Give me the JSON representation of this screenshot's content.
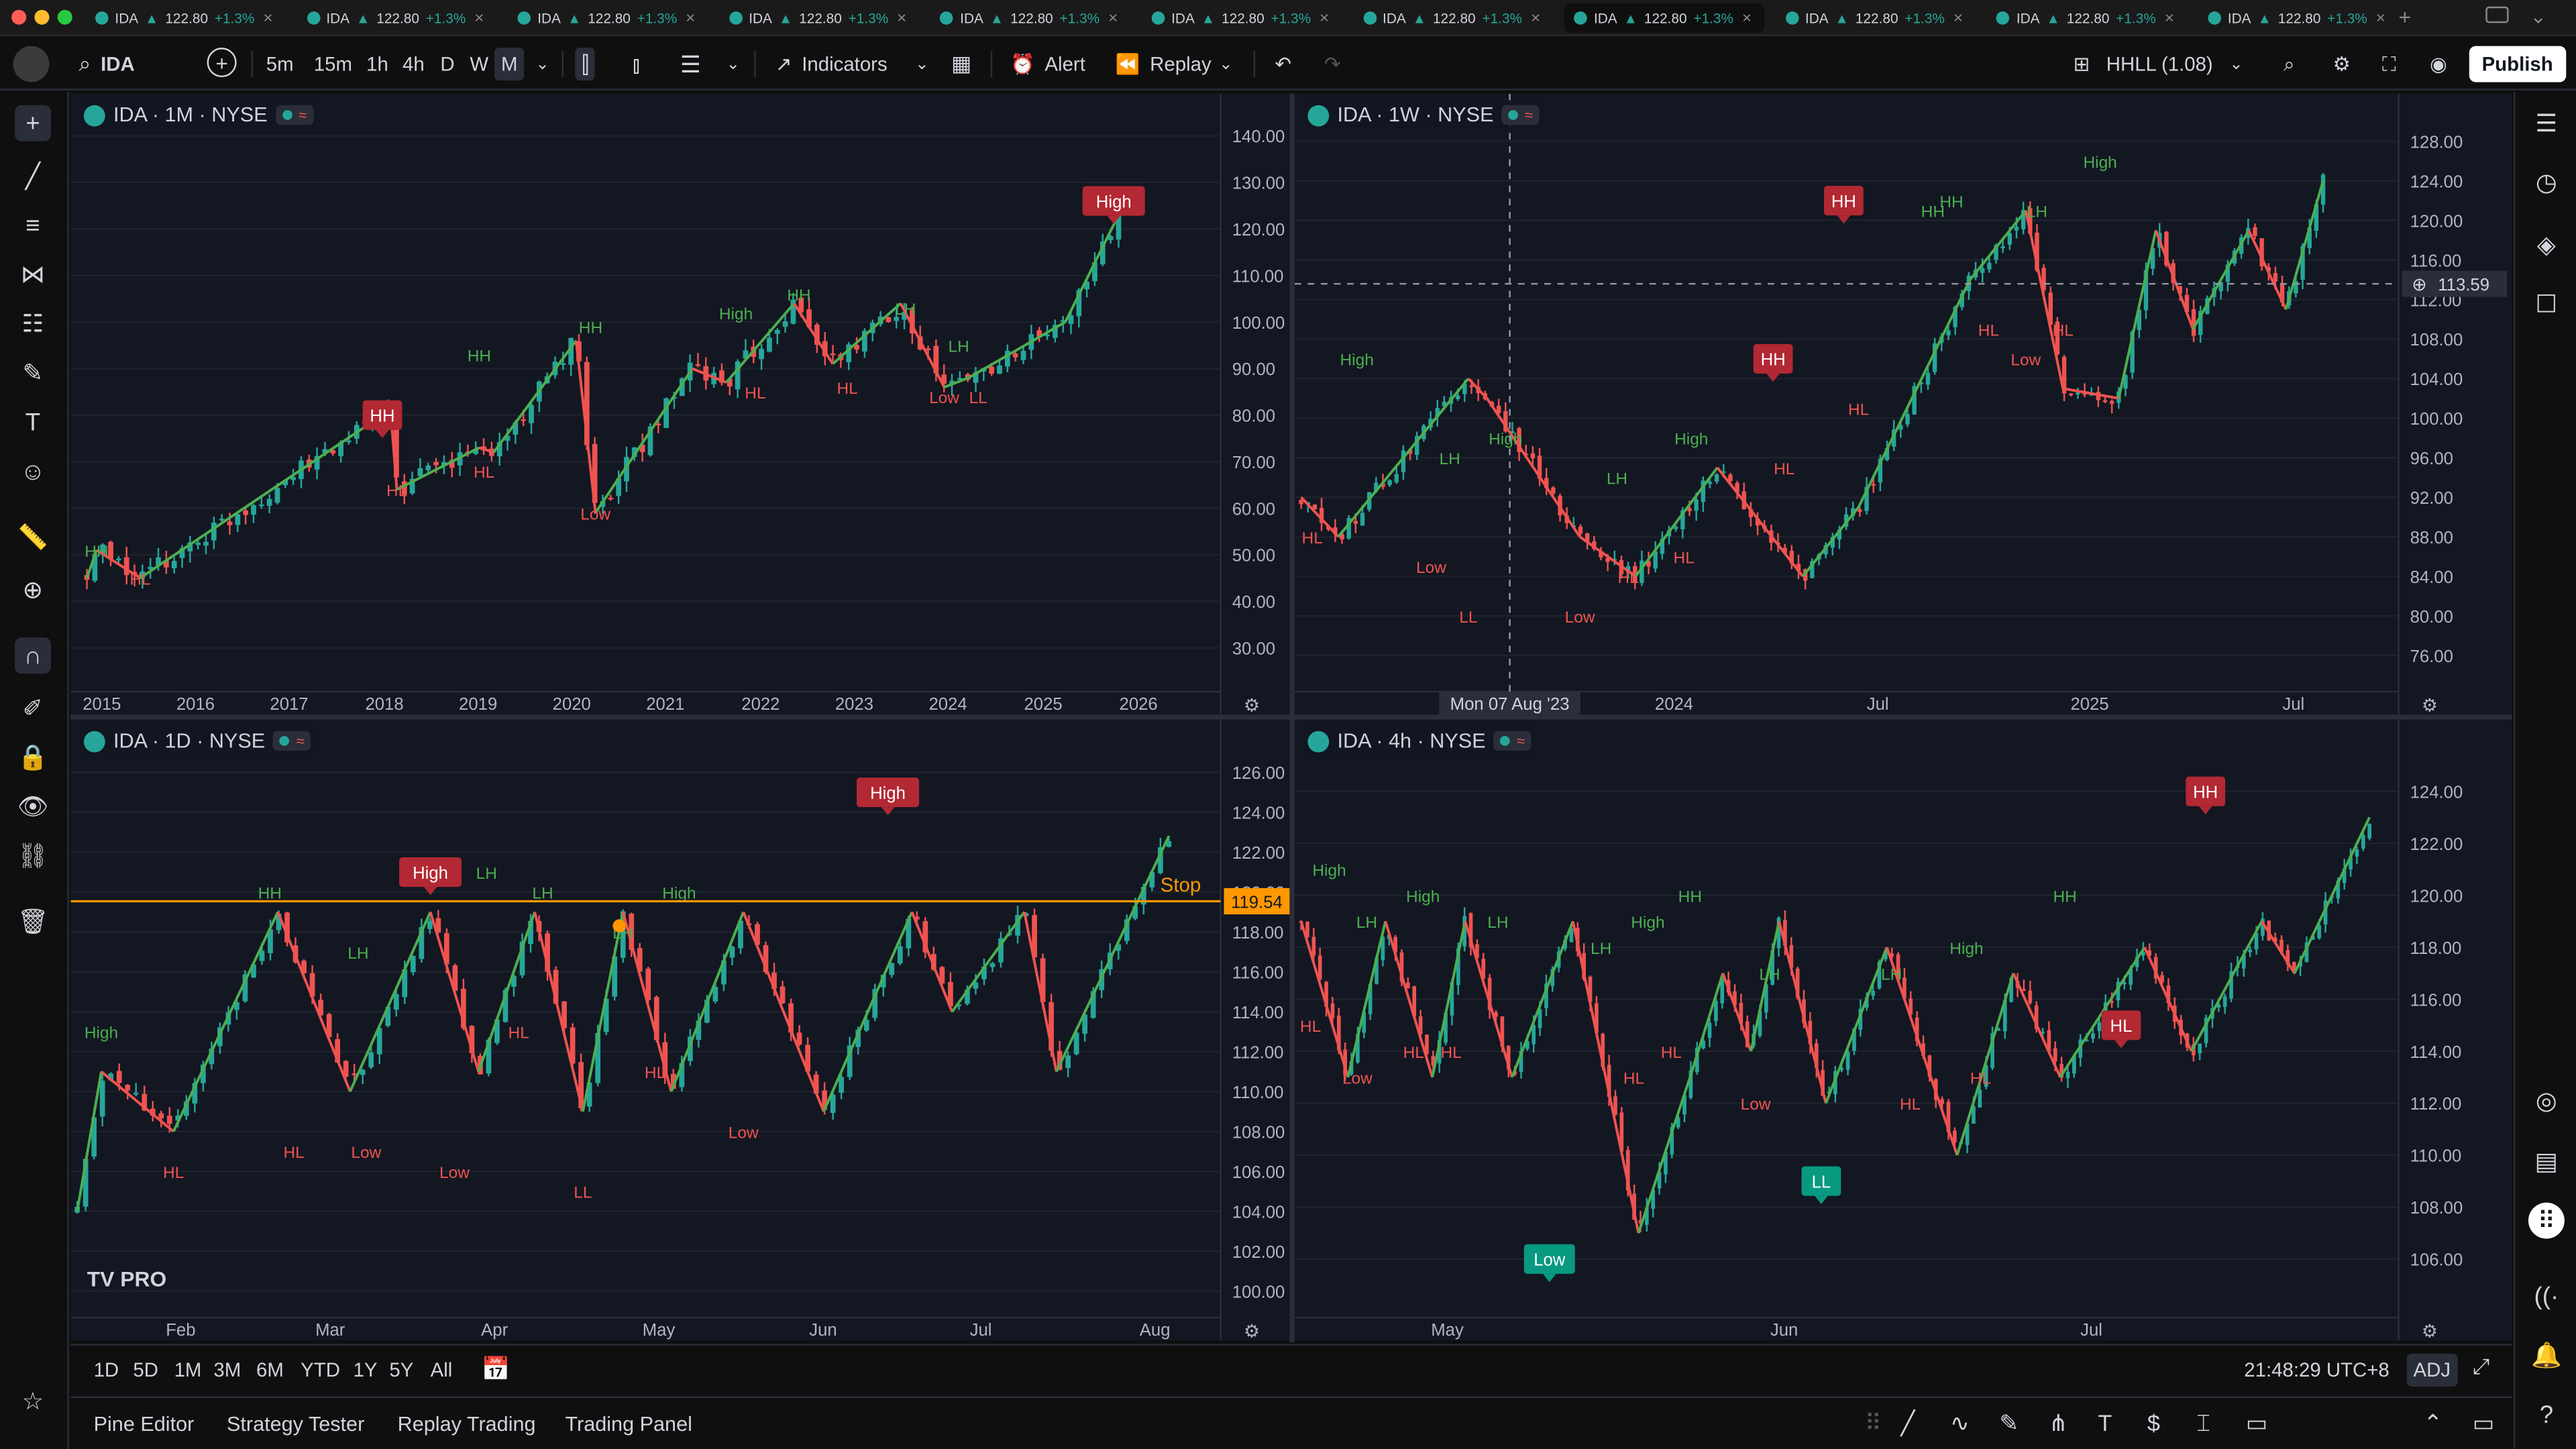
{
  "window": {
    "tab_count": 11,
    "active_tab_index": 7,
    "tab": {
      "symbol": "IDA",
      "price": "122.80",
      "change": "+1.3%"
    }
  },
  "toolbar": {
    "symbol": "IDA",
    "intervals": [
      "5m",
      "15m",
      "1h",
      "4h",
      "D",
      "W",
      "M"
    ],
    "selected_interval": "M",
    "indicators_label": "Indicators",
    "alert_label": "Alert",
    "replay_label": "Replay",
    "indicator_name": "HHLL (1.08)",
    "publish_label": "Publish"
  },
  "range_bar": {
    "ranges": [
      "1D",
      "5D",
      "1M",
      "3M",
      "6M",
      "YTD",
      "1Y",
      "5Y",
      "All"
    ],
    "clock": "21:48:29 UTC+8",
    "adj_label": "ADJ"
  },
  "bottom_bar": {
    "tabs": [
      "Pine Editor",
      "Strategy Tester",
      "Replay Trading",
      "Trading Panel"
    ]
  },
  "colors": {
    "up": "#26a69a",
    "down": "#ef5350",
    "zigzag": "#4caf50",
    "bg": "#131722",
    "stop_line": "#ff9800",
    "badge_red": "#b22833",
    "badge_green": "#089981"
  },
  "watermark": "TV PRO",
  "panes": [
    {
      "legend": "IDA · 1M · NYSE",
      "y_ticks": [
        "140.00",
        "130.00",
        "120.00",
        "110.00",
        "100.00",
        "90.00",
        "80.00",
        "70.00",
        "60.00",
        "50.00",
        "40.00",
        "30.00"
      ],
      "x_ticks": [
        "2015",
        "2016",
        "2017",
        "2018",
        "2019",
        "2020",
        "2021",
        "2022",
        "2023",
        "2024",
        "2025",
        "2026"
      ],
      "chart_data": {
        "type": "candlestick",
        "ylim": [
          22,
          142
        ],
        "xlim": [
          2014.8,
          2026.4
        ],
        "zigzag": [
          [
            2014.9,
            45
          ],
          [
            2015.0,
            51
          ],
          [
            2015.45,
            45
          ],
          [
            2017.95,
            80
          ],
          [
            2018.05,
            77
          ],
          [
            2018.1,
            64
          ],
          [
            2018.95,
            73
          ],
          [
            2019.1,
            72
          ],
          [
            2019.95,
            96
          ],
          [
            2020.15,
            59
          ],
          [
            2021.15,
            90
          ],
          [
            2021.5,
            87
          ],
          [
            2022.2,
            104
          ],
          [
            2022.6,
            91
          ],
          [
            2023.3,
            104
          ],
          [
            2023.75,
            86
          ],
          [
            2024.0,
            88
          ],
          [
            2025.0,
            100
          ],
          [
            2025.55,
            123
          ]
        ],
        "labels": [
          {
            "text": "HH",
            "x": 2015.0,
            "y": 51,
            "kind": "hh"
          },
          {
            "text": "HL",
            "x": 2015.45,
            "y": 45,
            "kind": "hl"
          },
          {
            "text": "HH",
            "x": 2017.95,
            "y": 80,
            "kind": "badge-red"
          },
          {
            "text": "HL",
            "x": 2018.1,
            "y": 64,
            "kind": "hl"
          },
          {
            "text": "HH",
            "x": 2018.95,
            "y": 93,
            "kind": "hh"
          },
          {
            "text": "HL",
            "x": 2019.0,
            "y": 68,
            "kind": "hl"
          },
          {
            "text": "HH",
            "x": 2020.1,
            "y": 99,
            "kind": "hh"
          },
          {
            "text": "Low",
            "x": 2020.15,
            "y": 59,
            "kind": "hl"
          },
          {
            "text": "High",
            "x": 2021.6,
            "y": 102,
            "kind": "hh"
          },
          {
            "text": "HL",
            "x": 2021.8,
            "y": 85,
            "kind": "hl"
          },
          {
            "text": "HH",
            "x": 2022.25,
            "y": 106,
            "kind": "hh"
          },
          {
            "text": "HL",
            "x": 2022.75,
            "y": 86,
            "kind": "hl"
          },
          {
            "text": "LH",
            "x": 2023.35,
            "y": 103,
            "kind": "hh"
          },
          {
            "text": "LH",
            "x": 2023.9,
            "y": 95,
            "kind": "hh"
          },
          {
            "text": "Low",
            "x": 2023.75,
            "y": 84,
            "kind": "hl"
          },
          {
            "text": "LL",
            "x": 2024.1,
            "y": 84,
            "kind": "hl"
          },
          {
            "text": "High",
            "x": 2025.5,
            "y": 126,
            "kind": "badge-red"
          }
        ]
      }
    },
    {
      "legend": "IDA · 1W · NYSE",
      "y_ticks": [
        "128.00",
        "124.00",
        "120.00",
        "116.00",
        "112.00",
        "108.00",
        "104.00",
        "100.00",
        "96.00",
        "92.00",
        "88.00",
        "84.00",
        "80.00",
        "76.00"
      ],
      "x_ticks": [
        "2024",
        "Jul",
        "2025",
        "Jul"
      ],
      "crosshair_price": "113.59",
      "crosshair_date": "Mon 07 Aug '23",
      "chart_data": {
        "type": "candlestick",
        "ylim": [
          73,
          129.5
        ],
        "xlim": [
          2023.0,
          2025.9
        ],
        "zigzag": [
          [
            2023.0,
            92
          ],
          [
            2023.1,
            88
          ],
          [
            2023.45,
            104
          ],
          [
            2023.5,
            102
          ],
          [
            2023.75,
            88
          ],
          [
            2023.9,
            84
          ],
          [
            2024.12,
            95
          ],
          [
            2024.35,
            84
          ],
          [
            2024.5,
            91
          ],
          [
            2024.8,
            114
          ],
          [
            2024.95,
            121
          ],
          [
            2025.05,
            103
          ],
          [
            2025.2,
            102
          ],
          [
            2025.3,
            119
          ],
          [
            2025.4,
            109
          ],
          [
            2025.55,
            119
          ],
          [
            2025.65,
            111
          ],
          [
            2025.75,
            124
          ]
        ],
        "labels": [
          {
            "text": "HL",
            "x": 2023.03,
            "y": 88,
            "kind": "hl"
          },
          {
            "text": "High",
            "x": 2023.15,
            "y": 106,
            "kind": "hh"
          },
          {
            "text": "Low",
            "x": 2023.35,
            "y": 85,
            "kind": "hl"
          },
          {
            "text": "LL",
            "x": 2023.45,
            "y": 80,
            "kind": "hl"
          },
          {
            "text": "LH",
            "x": 2023.4,
            "y": 96,
            "kind": "hh"
          },
          {
            "text": "High",
            "x": 2023.55,
            "y": 98,
            "kind": "hh"
          },
          {
            "text": "Low",
            "x": 2023.75,
            "y": 80,
            "kind": "hl"
          },
          {
            "text": "LH",
            "x": 2023.85,
            "y": 94,
            "kind": "hh"
          },
          {
            "text": "HL",
            "x": 2023.88,
            "y": 84,
            "kind": "hl"
          },
          {
            "text": "High",
            "x": 2024.05,
            "y": 98,
            "kind": "hh"
          },
          {
            "text": "HL",
            "x": 2024.03,
            "y": 86,
            "kind": "hl"
          },
          {
            "text": "HH",
            "x": 2024.27,
            "y": 106,
            "kind": "badge-red"
          },
          {
            "text": "HL",
            "x": 2024.3,
            "y": 95,
            "kind": "hl"
          },
          {
            "text": "HH",
            "x": 2024.46,
            "y": 122,
            "kind": "badge-red"
          },
          {
            "text": "HL",
            "x": 2024.5,
            "y": 101,
            "kind": "hl"
          },
          {
            "text": "HH",
            "x": 2024.7,
            "y": 121,
            "kind": "hh"
          },
          {
            "text": "HH",
            "x": 2024.75,
            "y": 122,
            "kind": "hh"
          },
          {
            "text": "HL",
            "x": 2024.85,
            "y": 109,
            "kind": "hl"
          },
          {
            "text": "Low",
            "x": 2024.95,
            "y": 106,
            "kind": "hl"
          },
          {
            "text": "LH",
            "x": 2024.98,
            "y": 121,
            "kind": "hh"
          },
          {
            "text": "HL",
            "x": 2025.05,
            "y": 109,
            "kind": "hl"
          },
          {
            "text": "High",
            "x": 2025.15,
            "y": 126,
            "kind": "hh"
          }
        ]
      }
    },
    {
      "legend": "IDA · 1D · NYSE",
      "y_ticks": [
        "126.00",
        "124.00",
        "122.00",
        "120.00",
        "118.00",
        "116.00",
        "114.00",
        "112.00",
        "110.00",
        "108.00",
        "106.00",
        "104.00",
        "102.00",
        "100.00"
      ],
      "x_ticks": [
        "Feb",
        "Mar",
        "Apr",
        "May",
        "Jun",
        "Jul",
        "Aug"
      ],
      "stop_label": "Stop",
      "stop_price": "119.54",
      "chart_data": {
        "type": "candlestick",
        "ylim": [
          99,
          127
        ],
        "stop_price": 119.54,
        "zigzag": [
          [
            0,
            104
          ],
          [
            3,
            111
          ],
          [
            12,
            108
          ],
          [
            25,
            119
          ],
          [
            34,
            110
          ],
          [
            44,
            119
          ],
          [
            50,
            111
          ],
          [
            57,
            119
          ],
          [
            63,
            109
          ],
          [
            68,
            119
          ],
          [
            72,
            113
          ],
          [
            74,
            110
          ],
          [
            83,
            119
          ],
          [
            93,
            109
          ],
          [
            104,
            119
          ],
          [
            109,
            114
          ],
          [
            118,
            119
          ],
          [
            122,
            111
          ],
          [
            136,
            122.8
          ]
        ],
        "labels": [
          {
            "text": "High",
            "x": 3,
            "y": 113,
            "kind": "hh"
          },
          {
            "text": "HL",
            "x": 12,
            "y": 106,
            "kind": "hl"
          },
          {
            "text": "HH",
            "x": 24,
            "y": 120,
            "kind": "hh"
          },
          {
            "text": "HL",
            "x": 27,
            "y": 107,
            "kind": "hl"
          },
          {
            "text": "LH",
            "x": 35,
            "y": 117,
            "kind": "hh"
          },
          {
            "text": "Low",
            "x": 36,
            "y": 107,
            "kind": "hl"
          },
          {
            "text": "High",
            "x": 44,
            "y": 121,
            "kind": "badge-red"
          },
          {
            "text": "Low",
            "x": 47,
            "y": 106,
            "kind": "hl"
          },
          {
            "text": "LH",
            "x": 51,
            "y": 121,
            "kind": "hh"
          },
          {
            "text": "LH",
            "x": 58,
            "y": 120,
            "kind": "hh"
          },
          {
            "text": "HL",
            "x": 55,
            "y": 113,
            "kind": "hl"
          },
          {
            "text": "LL",
            "x": 63,
            "y": 105,
            "kind": "hl"
          },
          {
            "text": "LH",
            "x": 68,
            "y": 118,
            "kind": "hh"
          },
          {
            "text": "HL",
            "x": 72,
            "y": 111,
            "kind": "hl"
          },
          {
            "text": "High",
            "x": 75,
            "y": 120,
            "kind": "hh"
          },
          {
            "text": "Low",
            "x": 83,
            "y": 108,
            "kind": "hl"
          },
          {
            "text": "High",
            "x": 101,
            "y": 125,
            "kind": "badge-red"
          }
        ]
      }
    },
    {
      "legend": "IDA · 4h · NYSE",
      "y_ticks": [
        "124.00",
        "122.00",
        "120.00",
        "118.00",
        "116.00",
        "114.00",
        "112.00",
        "110.00",
        "108.00",
        "106.00"
      ],
      "x_ticks": [
        "May",
        "Jun",
        "Jul"
      ],
      "chart_data": {
        "type": "candlestick",
        "ylim": [
          104,
          125.5
        ],
        "zigzag": [
          [
            0,
            119
          ],
          [
            10,
            113
          ],
          [
            18,
            119
          ],
          [
            28,
            113
          ],
          [
            35,
            119
          ],
          [
            45,
            113
          ],
          [
            58,
            119
          ],
          [
            72,
            107
          ],
          [
            83,
            113
          ],
          [
            90,
            117
          ],
          [
            96,
            114
          ],
          [
            102,
            119
          ],
          [
            112,
            112
          ],
          [
            125,
            118
          ],
          [
            140,
            110
          ],
          [
            152,
            117
          ],
          [
            162,
            113
          ],
          [
            180,
            118
          ],
          [
            190,
            114
          ],
          [
            205,
            119
          ],
          [
            212,
            117
          ],
          [
            228,
            123
          ]
        ],
        "labels": [
          {
            "text": "High",
            "x": 6,
            "y": 121,
            "kind": "hh"
          },
          {
            "text": "HL",
            "x": 2,
            "y": 115,
            "kind": "hl"
          },
          {
            "text": "LH",
            "x": 14,
            "y": 119,
            "kind": "hh"
          },
          {
            "text": "Low",
            "x": 12,
            "y": 113,
            "kind": "hl"
          },
          {
            "text": "High",
            "x": 26,
            "y": 120,
            "kind": "hh"
          },
          {
            "text": "HL",
            "x": 24,
            "y": 114,
            "kind": "hl"
          },
          {
            "text": "HL",
            "x": 32,
            "y": 114,
            "kind": "hl"
          },
          {
            "text": "LH",
            "x": 42,
            "y": 119,
            "kind": "hh"
          },
          {
            "text": "Low",
            "x": 53,
            "y": 106,
            "kind": "badge-green"
          },
          {
            "text": "LH",
            "x": 64,
            "y": 118,
            "kind": "hh"
          },
          {
            "text": "HL",
            "x": 71,
            "y": 113,
            "kind": "hl"
          },
          {
            "text": "High",
            "x": 74,
            "y": 119,
            "kind": "hh"
          },
          {
            "text": "HH",
            "x": 83,
            "y": 120,
            "kind": "hh"
          },
          {
            "text": "HL",
            "x": 79,
            "y": 114,
            "kind": "hl"
          },
          {
            "text": "LH",
            "x": 100,
            "y": 117,
            "kind": "hh"
          },
          {
            "text": "Low",
            "x": 97,
            "y": 112,
            "kind": "hl"
          },
          {
            "text": "LL",
            "x": 111,
            "y": 109,
            "kind": "badge-green"
          },
          {
            "text": "LH",
            "x": 126,
            "y": 117,
            "kind": "hh"
          },
          {
            "text": "HL",
            "x": 130,
            "y": 112,
            "kind": "hl"
          },
          {
            "text": "High",
            "x": 142,
            "y": 118,
            "kind": "hh"
          },
          {
            "text": "HL",
            "x": 145,
            "y": 113,
            "kind": "hl"
          },
          {
            "text": "HH",
            "x": 163,
            "y": 120,
            "kind": "hh"
          },
          {
            "text": "HL",
            "x": 175,
            "y": 115,
            "kind": "badge-red"
          },
          {
            "text": "HH",
            "x": 193,
            "y": 124,
            "kind": "badge-red"
          }
        ]
      }
    }
  ]
}
